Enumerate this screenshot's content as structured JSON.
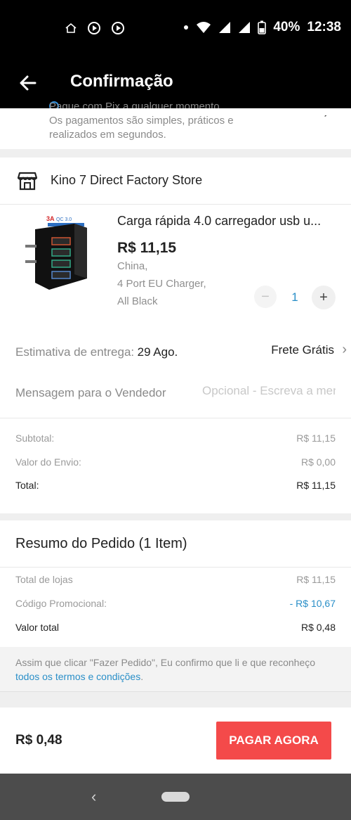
{
  "status_bar": {
    "battery": "40%",
    "time": "12:38",
    "icons": [
      "home-icon",
      "play-circle-icon",
      "play-circle-icon",
      "dot-icon",
      "wifi-icon",
      "signal-icon",
      "signal-icon",
      "battery-icon"
    ]
  },
  "app_bar": {
    "title": "Confirmação",
    "back_icon": "arrow-left-icon"
  },
  "pix_notice": {
    "line1": "Pague com Pix a qualquer momento.",
    "line2": "Os pagamentos são simples, práticos e",
    "line3": "realizados em segundos."
  },
  "store": {
    "name": "Kino 7 Direct Factory Store",
    "icon": "store-icon"
  },
  "product": {
    "title": "Carga rápida 4.0 carregador usb u...",
    "price": "R$ 11,15",
    "spec_line1": "China,",
    "spec_line2": "4 Port EU Charger,",
    "spec_line3": "All Black",
    "quantity": "1",
    "minus": "−",
    "plus": "+"
  },
  "delivery": {
    "label": "Estimativa de entrega:",
    "date": "29 Ago.",
    "shipping": "Frete Grátis"
  },
  "message": {
    "label": "Mensagem para o Vendedor",
    "placeholder": "Opcional - Escreva a mensagem"
  },
  "store_summary": {
    "subtotal_label": "Subtotal:",
    "subtotal_value": "R$ 11,15",
    "shipping_label": "Valor do Envio:",
    "shipping_value": "R$ 0,00",
    "total_label": "Total:",
    "total_value": "R$ 11,15"
  },
  "order_summary": {
    "title": "Resumo do Pedido (1 Item)",
    "stores_label": "Total de lojas",
    "stores_value": "R$ 11,15",
    "promo_label": "Código Promocional:",
    "promo_value": "- R$ 10,67",
    "total_label": "Valor total",
    "total_value": "R$ 0,48"
  },
  "terms": {
    "text": "Assim que clicar \"Fazer Pedido\", Eu confirmo que li e que reconheço ",
    "link": "todos os termos e condições",
    "end": "."
  },
  "footer": {
    "total": "R$ 0,48",
    "pay_button": "PAGAR AGORA"
  },
  "colors": {
    "accent_red": "#f44a4a",
    "link_blue": "#2a8fc8"
  }
}
